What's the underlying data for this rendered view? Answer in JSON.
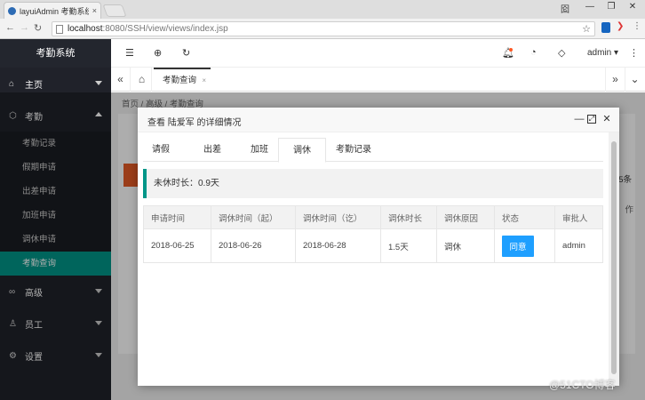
{
  "browser": {
    "tab_title": "layuiAdmin 考勤系统",
    "tab_close": "×",
    "url_host": "localhost",
    "url_path": ":8080/SSH/view/views/index.jsp",
    "win_min": "—",
    "win_max": "❐",
    "win_close": "✕",
    "win_user": "囵",
    "icons": [
      "back-icon",
      "forward-icon",
      "reload-icon",
      "star-icon",
      "extension-icon",
      "menu-icon"
    ]
  },
  "sidebar": {
    "title": "考勤系统",
    "items": [
      {
        "label": "主页",
        "icon": "home-icon",
        "expanded": false
      },
      {
        "label": "考勤",
        "icon": "check-icon",
        "expanded": true
      },
      {
        "label": "高级",
        "icon": "senior-icon",
        "expanded": false
      },
      {
        "label": "员工",
        "icon": "user-icon",
        "expanded": false
      },
      {
        "label": "设置",
        "icon": "settings-icon",
        "expanded": false
      }
    ],
    "subitems": [
      {
        "label": "考勤记录",
        "active": false
      },
      {
        "label": "假期申请",
        "active": false
      },
      {
        "label": "出差申请",
        "active": false
      },
      {
        "label": "加班申请",
        "active": false
      },
      {
        "label": "调休申请",
        "active": false
      },
      {
        "label": "考勤查询",
        "active": true
      }
    ],
    "active_color": "#009688"
  },
  "header": {
    "user": "admin",
    "icons": [
      "shrink-icon",
      "website-icon",
      "refresh-icon",
      "notice-icon",
      "theme-icon",
      "note-icon",
      "more-icon"
    ]
  },
  "pagetabs": {
    "active_label": "考勤查询",
    "close": "×"
  },
  "content": {
    "breadcrumb": [
      "首页",
      "高级",
      "考勤查询"
    ],
    "partial_right": "5条",
    "partial_right2": "作"
  },
  "dialog": {
    "title": "查看 陆爱军 的详细情况",
    "tabs": [
      "请假",
      "出差",
      "加班",
      "调休",
      "考勤记录"
    ],
    "active_tab": "调休",
    "summary": "未休时长：0.9天",
    "columns": [
      "申请时间",
      "调休时间（起）",
      "调休时间（讫）",
      "调休时长",
      "调休原因",
      "状态",
      "审批人"
    ],
    "rows": [
      {
        "apply": "2018-06-25",
        "from": "2018-06-26",
        "to": "2018-06-28",
        "duration": "1.5天",
        "reason": "调休",
        "status": "同意",
        "approver": "admin"
      }
    ],
    "status_color": "#1e9fff"
  },
  "watermark": "@51CTO博客"
}
